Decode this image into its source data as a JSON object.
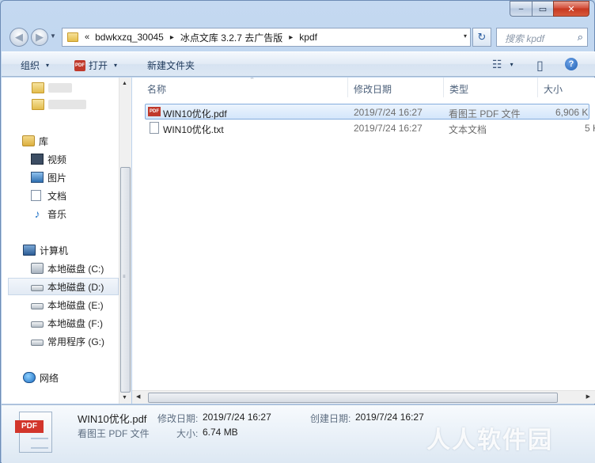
{
  "window": {
    "minimize_glyph": "–",
    "maximize_glyph": "▭",
    "close_glyph": "✕"
  },
  "address_bar": {
    "overflow": "«",
    "segments": [
      "bdwkxzq_30045",
      "冰点文库 3.2.7 去广告版",
      "kpdf"
    ],
    "separator": "▸",
    "dropdown": "▾",
    "refresh_glyph": "↻"
  },
  "search": {
    "placeholder": "搜索 kpdf",
    "icon": "search-icon",
    "glyph": "⌕"
  },
  "toolbar": {
    "organize": "组织",
    "open": "打开",
    "open_icon_text": "PDF",
    "new_folder": "新建文件夹",
    "dropdown": "▾",
    "view_glyph": "☷",
    "preview_glyph": "▯",
    "help_glyph": "?"
  },
  "nav": {
    "libraries": "库",
    "videos": "视频",
    "pictures": "图片",
    "documents": "文档",
    "music": "音乐",
    "computer": "计算机",
    "drives": [
      {
        "label": "本地磁盘 (C:)"
      },
      {
        "label": "本地磁盘 (D:)",
        "selected": true
      },
      {
        "label": "本地磁盘 (E:)"
      },
      {
        "label": "本地磁盘 (F:)"
      },
      {
        "label": "常用程序 (G:)"
      }
    ],
    "network": "网络",
    "music_glyph": "♪"
  },
  "columns": {
    "name": "名称",
    "modified": "修改日期",
    "type": "类型",
    "size": "大小",
    "sort_glyph": "^"
  },
  "files": [
    {
      "name": "WIN10优化.pdf",
      "modified": "2019/7/24 16:27",
      "type": "看图王 PDF 文件",
      "size": "6,906 K",
      "icon": "pdf-file-icon",
      "icon_text": "PDF",
      "selected": true
    },
    {
      "name": "WIN10优化.txt",
      "modified": "2019/7/24 16:27",
      "type": "文本文档",
      "size": "5 K",
      "icon": "text-file-icon",
      "selected": false
    }
  ],
  "details": {
    "filename": "WIN10优化.pdf",
    "modified_label": "修改日期:",
    "modified_value": "2019/7/24 16:27",
    "created_label": "创建日期:",
    "created_value": "2019/7/24 16:27",
    "type_value": "看图王 PDF 文件",
    "size_label": "大小:",
    "size_value": "6.74 MB",
    "icon_text": "PDF"
  },
  "scroll": {
    "up": "▲",
    "down": "▼",
    "left": "◀",
    "right": "▶",
    "grip": "≡"
  },
  "watermark": "人人软件园"
}
